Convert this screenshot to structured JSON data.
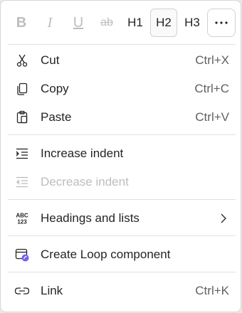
{
  "toolbar": {
    "bold": "B",
    "italic": "I",
    "underline": "U",
    "strikethrough": "ab",
    "h1": "H1",
    "h2": "H2",
    "h3": "H3",
    "more": "···",
    "selected": "H2"
  },
  "menu": {
    "cut": {
      "label": "Cut",
      "shortcut": "Ctrl+X",
      "icon": "scissors-icon"
    },
    "copy": {
      "label": "Copy",
      "shortcut": "Ctrl+C",
      "icon": "copy-icon"
    },
    "paste": {
      "label": "Paste",
      "shortcut": "Ctrl+V",
      "icon": "paste-icon"
    },
    "increase_indent": {
      "label": "Increase indent",
      "icon": "increase-indent-icon"
    },
    "decrease_indent": {
      "label": "Decrease indent",
      "icon": "decrease-indent-icon",
      "disabled": true
    },
    "headings_lists": {
      "label": "Headings and lists",
      "icon": "abc-123-icon",
      "icon_text_top": "ABC",
      "icon_text_bottom": "123"
    },
    "loop": {
      "label": "Create Loop component",
      "icon": "loop-component-icon"
    },
    "link": {
      "label": "Link",
      "shortcut": "Ctrl+K",
      "icon": "link-icon"
    }
  },
  "colors": {
    "text": "#242424",
    "shortcut": "#616161",
    "disabled": "#bdbdbd",
    "loop_accent": "#7b5cf5"
  }
}
